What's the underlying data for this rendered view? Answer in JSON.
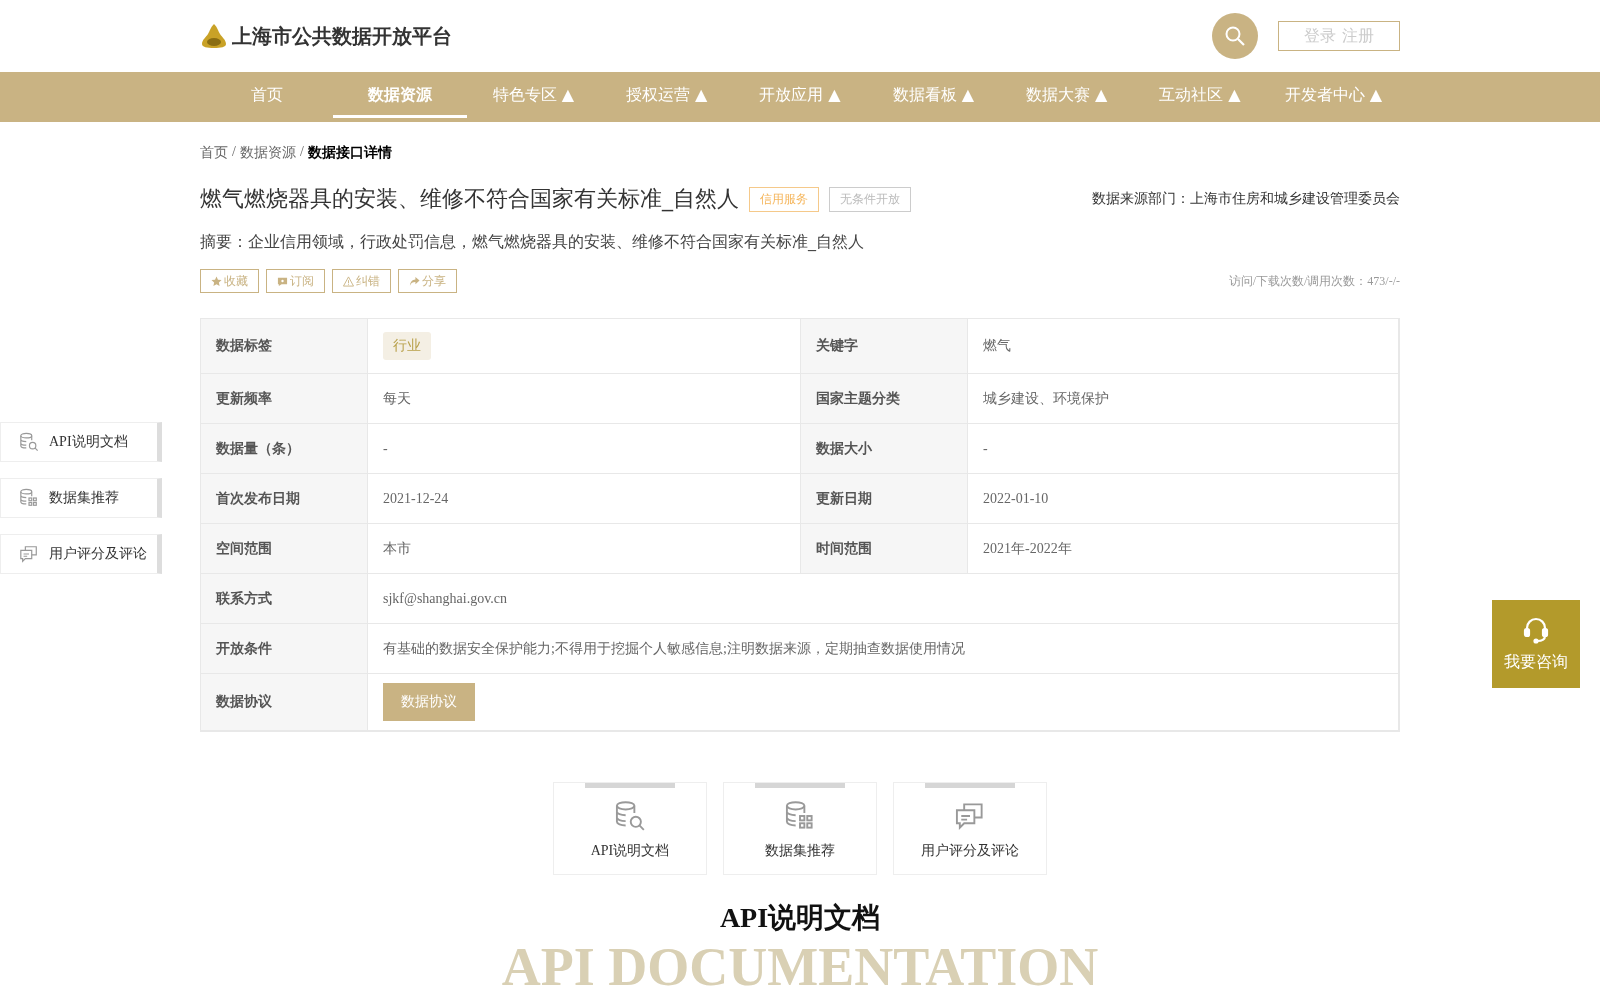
{
  "header": {
    "site_title": "上海市公共数据开放平台",
    "login": "登录 注册"
  },
  "nav": [
    {
      "label": "首页",
      "selected": false
    },
    {
      "label": "数据资源",
      "selected": true
    },
    {
      "label": "特色专区 ▲",
      "selected": false
    },
    {
      "label": "授权运营 ▲",
      "selected": false
    },
    {
      "label": "开放应用 ▲",
      "selected": false
    },
    {
      "label": "数据看板 ▲",
      "selected": false
    },
    {
      "label": "数据大赛 ▲",
      "selected": false
    },
    {
      "label": "互动社区 ▲",
      "selected": false
    },
    {
      "label": "开发者中心 ▲",
      "selected": false
    }
  ],
  "breadcrumb": [
    {
      "kind": "link",
      "label": "首页",
      "current": false
    },
    {
      "kind": "separator",
      "label": "/"
    },
    {
      "kind": "link",
      "label": "数据资源",
      "current": false
    },
    {
      "kind": "separator",
      "label": "/"
    },
    {
      "kind": "link",
      "label": "数据接口详情",
      "current": true
    }
  ],
  "title": "燃气燃烧器具的安装、维修不符合国家有关标准_自然人",
  "title_tags": [
    {
      "label": "信用服务",
      "kind": "accent"
    },
    {
      "label": "无条件开放",
      "kind": "muted"
    }
  ],
  "source": "数据来源部门：上海市住房和城乡建设管理委员会",
  "summary": "摘要：企业信用领域，行政处罚信息，燃气燃烧器具的安装、维修不符合国家有关标准_自然人",
  "actions": [
    {
      "label": "收藏",
      "kind": "star"
    },
    {
      "label": "订阅",
      "kind": "subscribe"
    },
    {
      "label": "纠错",
      "kind": "warning"
    },
    {
      "label": "分享",
      "kind": "share"
    }
  ],
  "stats": "访问/下载次数/调用次数：473/-/-",
  "table": [
    {
      "fields": [
        {
          "label": "数据标签",
          "kind": "tag",
          "value": "行业"
        },
        {
          "label": "关键字",
          "kind": "text",
          "value": "燃气"
        }
      ]
    },
    {
      "fields": [
        {
          "label": "更新频率",
          "kind": "text",
          "value": "每天"
        },
        {
          "label": "国家主题分类",
          "kind": "text",
          "value": "城乡建设、环境保护"
        }
      ]
    },
    {
      "fields": [
        {
          "label": "数据量（条）",
          "kind": "text",
          "value": "-"
        },
        {
          "label": "数据大小",
          "kind": "text",
          "value": "-"
        }
      ]
    },
    {
      "fields": [
        {
          "label": "首次发布日期",
          "kind": "text",
          "value": "2021-12-24"
        },
        {
          "label": "更新日期",
          "kind": "text",
          "value": "2022-01-10"
        }
      ]
    },
    {
      "fields": [
        {
          "label": "空间范围",
          "kind": "text",
          "value": "本市"
        },
        {
          "label": "时间范围",
          "kind": "text",
          "value": "2021年-2022年"
        }
      ]
    },
    {
      "fields": [
        {
          "label": "联系方式",
          "kind": "text",
          "value": "sjkf@shanghai.gov.cn"
        }
      ]
    },
    {
      "fields": [
        {
          "label": "开放条件",
          "kind": "text",
          "value": "有基础的数据安全保护能力;不得用于挖掘个人敏感信息;注明数据来源，定期抽查数据使用情况"
        }
      ]
    },
    {
      "fields": [
        {
          "label": "数据协议",
          "kind": "button",
          "value": "数据协议"
        }
      ]
    }
  ],
  "side_nav": [
    {
      "label": "API说明文档",
      "kind": "api"
    },
    {
      "label": "数据集推荐",
      "kind": "dataset"
    },
    {
      "label": "用户评分及评论",
      "kind": "comment"
    }
  ],
  "cards": [
    {
      "label": "API说明文档",
      "kind": "api"
    },
    {
      "label": "数据集推荐",
      "kind": "dataset"
    },
    {
      "label": "用户评分及评论",
      "kind": "comment"
    }
  ],
  "consult": "我要咨询",
  "section": {
    "backdrop": "API DOCUMENTATION",
    "title": "API说明文档"
  }
}
